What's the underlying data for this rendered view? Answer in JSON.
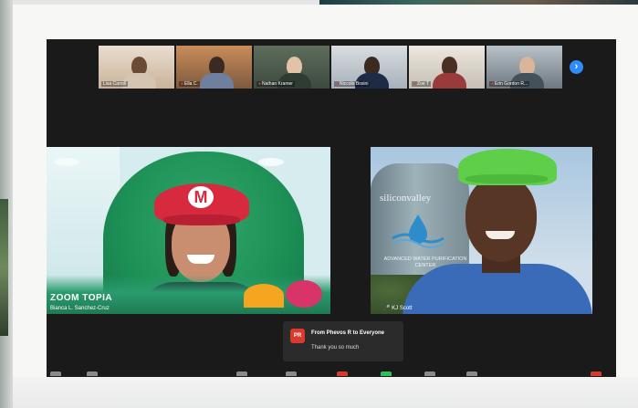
{
  "gallery": {
    "participants": [
      {
        "name": "Lisa Carroll",
        "muted": false
      },
      {
        "name": "Ella C.",
        "muted": true
      },
      {
        "name": "Nathan Kramer",
        "muted": true
      },
      {
        "name": "Niccolo Bosini",
        "muted": true
      },
      {
        "name": "Zoe T",
        "muted": true
      },
      {
        "name": "Erin Gordon R...",
        "muted": true
      }
    ],
    "next_icon": "chevron-right-icon"
  },
  "main_videos": {
    "left": {
      "name": "Bianca L. Sanchez-Cruz",
      "watermark": "ZOOM TOPIA"
    },
    "right": {
      "name": "KJ Scott",
      "background_text": "siliconvalley",
      "background_subtext": "ADVANCED WATER PURIFICATION CENTER"
    }
  },
  "chat_toast": {
    "avatar": "PR",
    "title": "From Phevos R to Everyone",
    "message": "Thank you so much"
  },
  "colors": {
    "zoom_bg": "#1a1a1a",
    "accent_blue": "#2d8cff",
    "mute_red": "#e0433a"
  }
}
